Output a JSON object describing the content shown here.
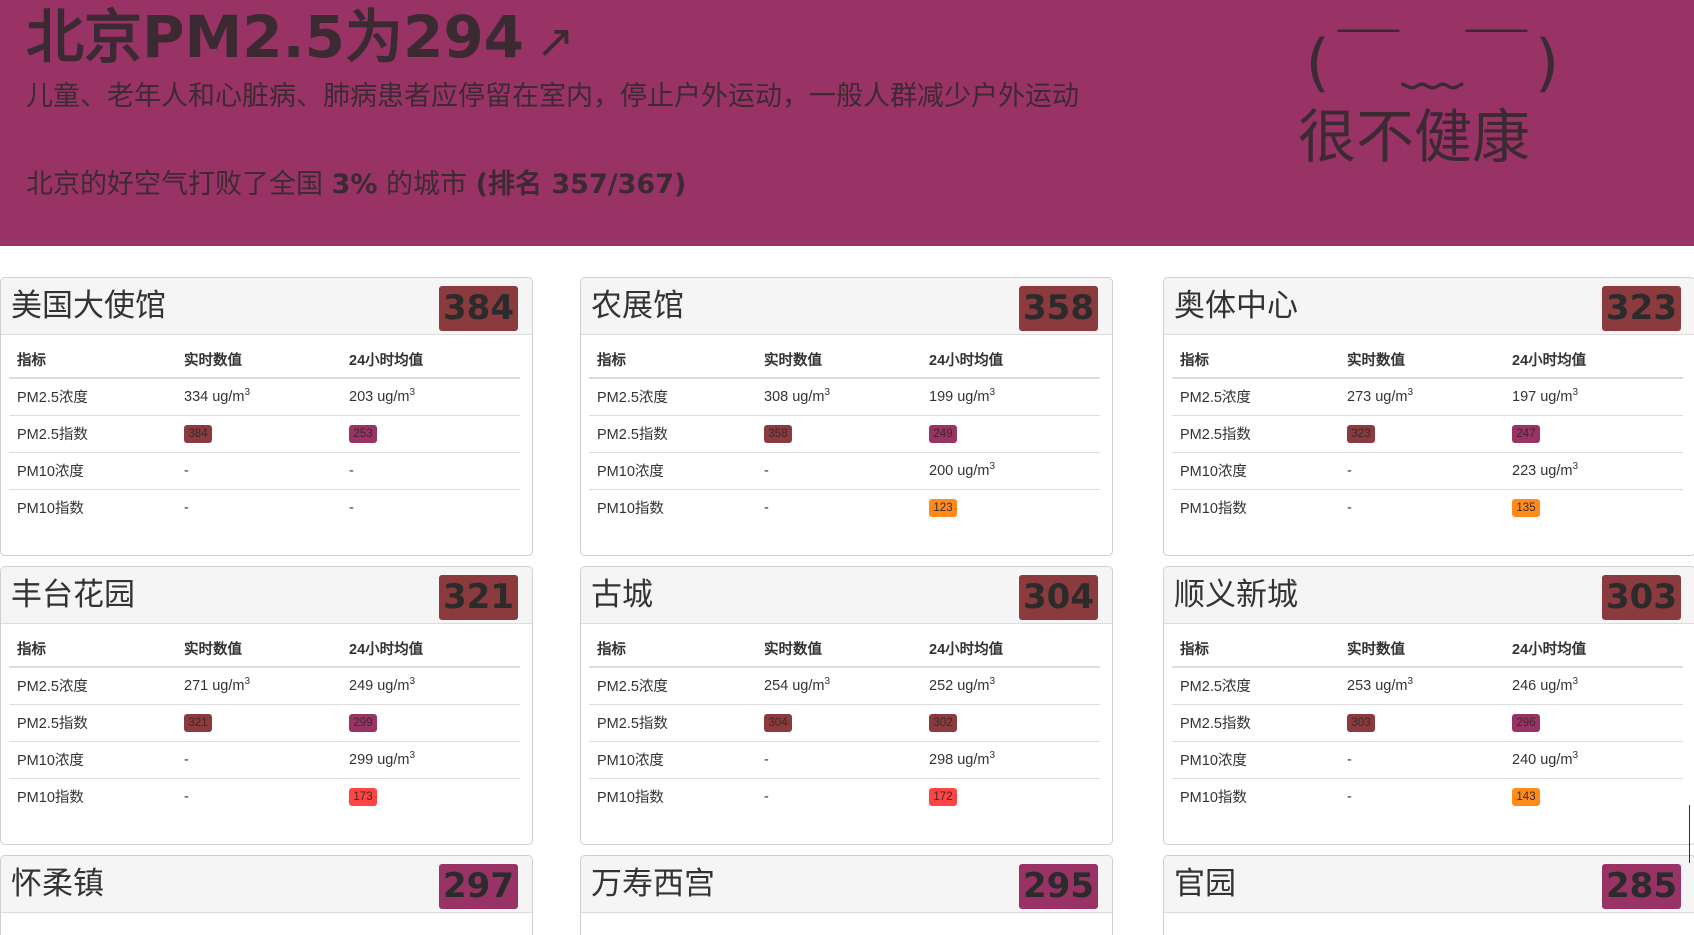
{
  "header": {
    "title": "北京PM2.5为294",
    "trend_arrow": "↗",
    "advice": "儿童、老年人和心脏病、肺病患者应停留在室内，停止户外运动，一般人群减少户外运动",
    "rank_prefix": "北京的好空气打败了全国",
    "rank_percent": "3%",
    "rank_mid": "的城市",
    "rank_paren": "(排名 357/367)",
    "face": "(￣﹏￣)",
    "level": "很不健康",
    "bg_color": "#993366"
  },
  "table_headers": {
    "metric": "指标",
    "realtime": "实时数值",
    "avg24": "24小时均值"
  },
  "row_labels": {
    "pm25_conc": "PM2.5浓度",
    "pm25_index": "PM2.5指数",
    "pm10_conc": "PM10浓度",
    "pm10_index": "PM10指数"
  },
  "unit": "ug/m",
  "unit_sup": "3",
  "colors": {
    "hazardous": "#8b3a3e",
    "very_unhealthy": "#993366",
    "unhealthy": "#ff4444",
    "sensitive": "#ff8c1a"
  },
  "stations": [
    {
      "name": "美国大使馆",
      "aqi": "384",
      "aqi_color": "#8b3a3e",
      "pm25_rt": "334",
      "pm25_avg": "203",
      "pm25_idx_rt": "384",
      "pm25_idx_rt_color": "#8b3a3e",
      "pm25_idx_avg": "253",
      "pm25_idx_avg_color": "#993366",
      "pm10_rt": "-",
      "pm10_avg": "-",
      "pm10_idx_rt": "-",
      "pm10_idx_avg": "-",
      "pm10_idx_avg_color": ""
    },
    {
      "name": "农展馆",
      "aqi": "358",
      "aqi_color": "#8b3a3e",
      "pm25_rt": "308",
      "pm25_avg": "199",
      "pm25_idx_rt": "358",
      "pm25_idx_rt_color": "#8b3a3e",
      "pm25_idx_avg": "249",
      "pm25_idx_avg_color": "#993366",
      "pm10_rt": "-",
      "pm10_avg": "200",
      "pm10_idx_rt": "-",
      "pm10_idx_avg": "123",
      "pm10_idx_avg_color": "#ff8c1a"
    },
    {
      "name": "奥体中心",
      "aqi": "323",
      "aqi_color": "#8b3a3e",
      "pm25_rt": "273",
      "pm25_avg": "197",
      "pm25_idx_rt": "323",
      "pm25_idx_rt_color": "#8b3a3e",
      "pm25_idx_avg": "247",
      "pm25_idx_avg_color": "#993366",
      "pm10_rt": "-",
      "pm10_avg": "223",
      "pm10_idx_rt": "-",
      "pm10_idx_avg": "135",
      "pm10_idx_avg_color": "#ff8c1a"
    },
    {
      "name": "丰台花园",
      "aqi": "321",
      "aqi_color": "#8b3a3e",
      "pm25_rt": "271",
      "pm25_avg": "249",
      "pm25_idx_rt": "321",
      "pm25_idx_rt_color": "#8b3a3e",
      "pm25_idx_avg": "299",
      "pm25_idx_avg_color": "#993366",
      "pm10_rt": "-",
      "pm10_avg": "299",
      "pm10_idx_rt": "-",
      "pm10_idx_avg": "173",
      "pm10_idx_avg_color": "#ff4444"
    },
    {
      "name": "古城",
      "aqi": "304",
      "aqi_color": "#8b3a3e",
      "pm25_rt": "254",
      "pm25_avg": "252",
      "pm25_idx_rt": "304",
      "pm25_idx_rt_color": "#8b3a3e",
      "pm25_idx_avg": "302",
      "pm25_idx_avg_color": "#8b3a3e",
      "pm10_rt": "-",
      "pm10_avg": "298",
      "pm10_idx_rt": "-",
      "pm10_idx_avg": "172",
      "pm10_idx_avg_color": "#ff4444"
    },
    {
      "name": "顺义新城",
      "aqi": "303",
      "aqi_color": "#8b3a3e",
      "pm25_rt": "253",
      "pm25_avg": "246",
      "pm25_idx_rt": "303",
      "pm25_idx_rt_color": "#8b3a3e",
      "pm25_idx_avg": "296",
      "pm25_idx_avg_color": "#993366",
      "pm10_rt": "-",
      "pm10_avg": "240",
      "pm10_idx_rt": "-",
      "pm10_idx_avg": "143",
      "pm10_idx_avg_color": "#ff8c1a"
    },
    {
      "name": "怀柔镇",
      "aqi": "297",
      "aqi_color": "#993366"
    },
    {
      "name": "万寿西宫",
      "aqi": "295",
      "aqi_color": "#993366"
    },
    {
      "name": "官园",
      "aqi": "285",
      "aqi_color": "#993366"
    }
  ]
}
